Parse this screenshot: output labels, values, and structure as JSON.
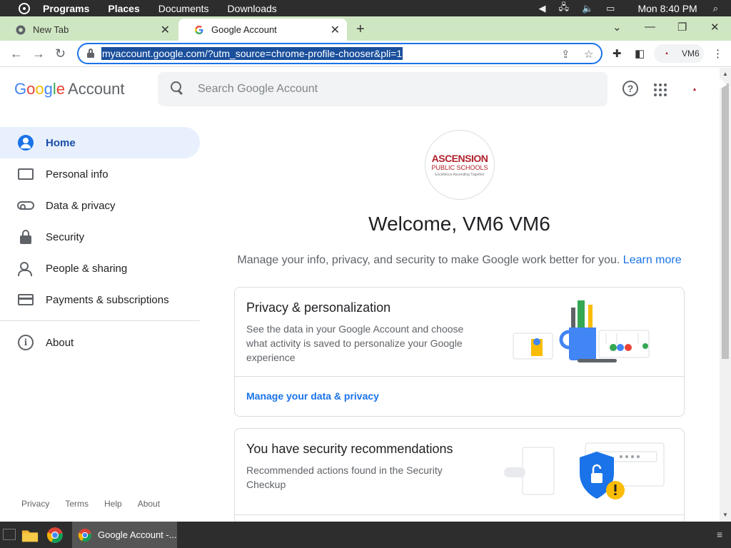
{
  "os_panel": {
    "menu": [
      "Programs",
      "Places",
      "Documents",
      "Downloads"
    ],
    "clock": "Mon 8:40 PM"
  },
  "tabs": [
    {
      "title": "New Tab"
    },
    {
      "title": "Google Account"
    }
  ],
  "toolbar": {
    "url": "myaccount.google.com/?utm_source=chrome-profile-chooser&pli=1",
    "profile_name": "VM6"
  },
  "header": {
    "logo_google": "Google",
    "logo_account": "Account",
    "search_placeholder": "Search Google Account"
  },
  "sidebar": {
    "items": [
      {
        "label": "Home",
        "icon": "home-icon",
        "active": true
      },
      {
        "label": "Personal info",
        "icon": "id-card-icon"
      },
      {
        "label": "Data & privacy",
        "icon": "toggle-icon"
      },
      {
        "label": "Security",
        "icon": "lock-icon"
      },
      {
        "label": "People & sharing",
        "icon": "people-icon"
      },
      {
        "label": "Payments & subscriptions",
        "icon": "credit-card-icon"
      }
    ],
    "about": {
      "label": "About",
      "icon": "info-icon"
    },
    "footer": [
      "Privacy",
      "Terms",
      "Help",
      "About"
    ]
  },
  "main": {
    "org_logo": {
      "line1": "ASCENSION",
      "line2": "PUBLIC SCHOOLS",
      "line3": "Excellence Ascending Together"
    },
    "welcome": "Welcome, VM6 VM6",
    "subtitle": "Manage your info, privacy, and security to make Google work better for you.",
    "learn_more": "Learn more",
    "cards": [
      {
        "title": "Privacy & personalization",
        "description": "See the data in your Google Account and choose what activity is saved to personalize your Google experience",
        "link": "Manage your data & privacy"
      },
      {
        "title": "You have security recommendations",
        "description": "Recommended actions found in the Security Checkup"
      }
    ]
  },
  "taskbar": {
    "active_window": "Google Account -..."
  },
  "colors": {
    "accent": "#1a73e8",
    "tab_strip": "#cfe6c2",
    "active_nav_bg": "#e8f0fe",
    "org_red": "#b0202a"
  }
}
